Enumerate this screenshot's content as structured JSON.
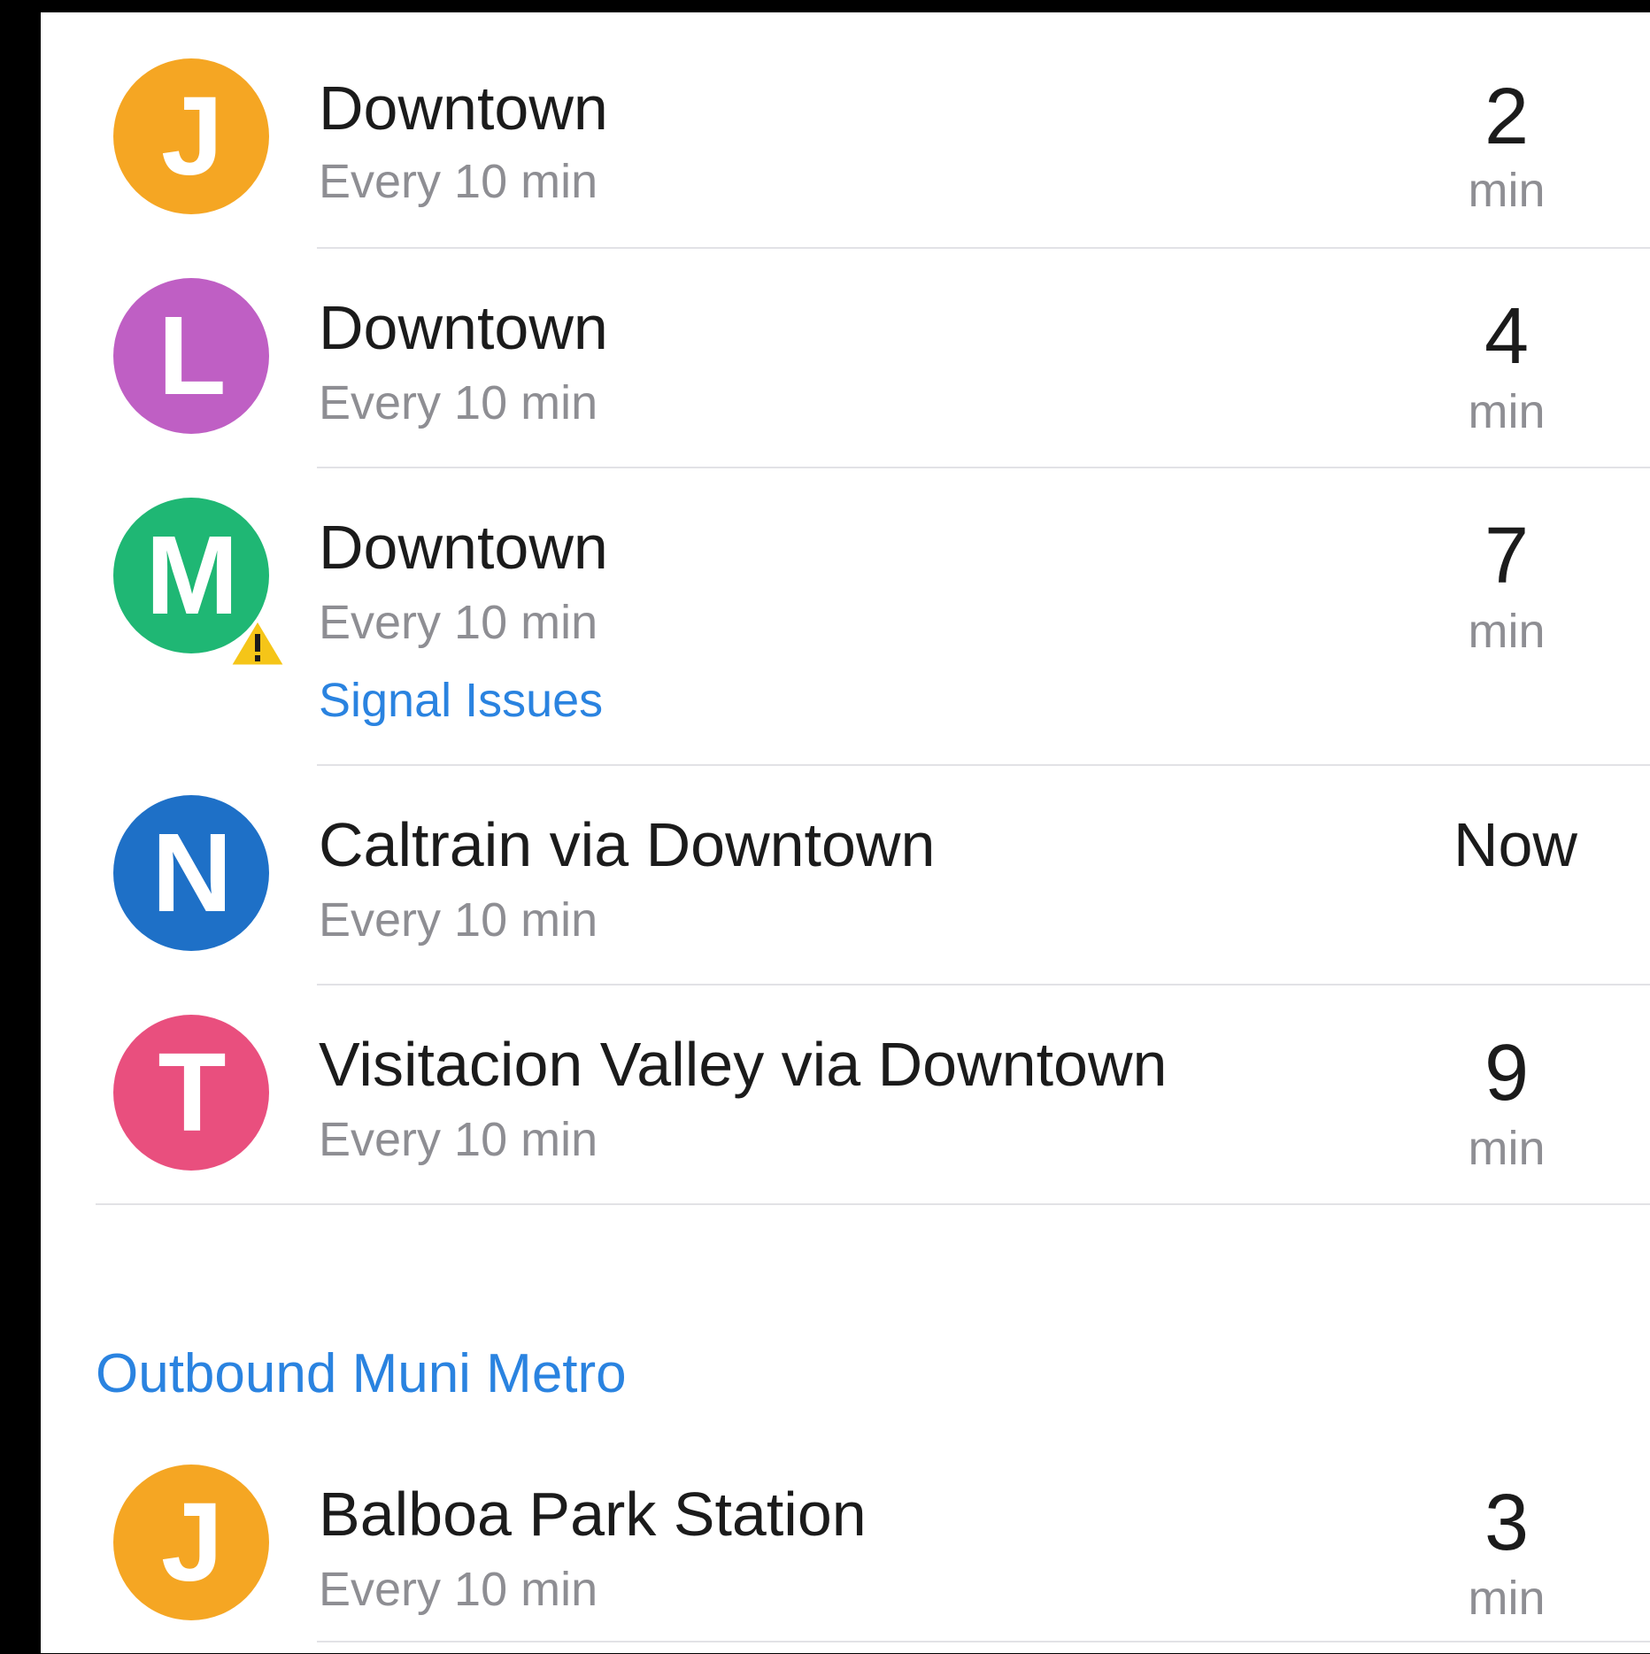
{
  "colors": {
    "J": "#f5a623",
    "L": "#bf5fc4",
    "M": "#1fb774",
    "N": "#1e70c7",
    "T": "#e94f7e",
    "alert": "#2a83e0",
    "warning": "#f5c518"
  },
  "inbound": [
    {
      "line": "J",
      "destination": "Downtown",
      "frequency": "Every 10 min",
      "time": "2",
      "unit": "min"
    },
    {
      "line": "L",
      "destination": "Downtown",
      "frequency": "Every 10 min",
      "time": "4",
      "unit": "min"
    },
    {
      "line": "M",
      "destination": "Downtown",
      "frequency": "Every 10 min",
      "alert": "Signal Issues",
      "warning_icon": "warning-triangle-icon",
      "time": "7",
      "unit": "min"
    },
    {
      "line": "N",
      "destination": "Caltrain via Downtown",
      "frequency": "Every 10 min",
      "time": "Now"
    },
    {
      "line": "T",
      "destination": "Visitacion Valley via Downtown",
      "frequency": "Every 10 min",
      "time": "9",
      "unit": "min"
    }
  ],
  "outbound_section": {
    "title": "Outbound Muni Metro",
    "items": [
      {
        "line": "J",
        "destination": "Balboa Park Station",
        "frequency": "Every 10 min",
        "time": "3",
        "unit": "min"
      }
    ]
  }
}
